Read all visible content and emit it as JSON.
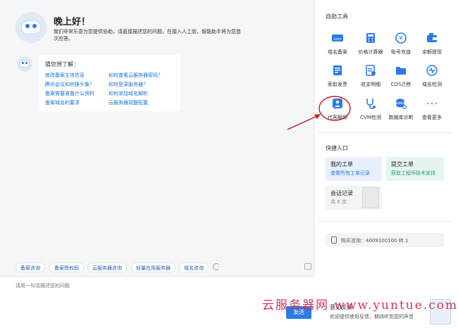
{
  "greeting": {
    "title": "晚上好！",
    "text": "我们非常乐意为您提供协助，请直接描述您的问题，在接入人工前，智能助手将为您首次应答。"
  },
  "guess": {
    "title": "猜您想了解：",
    "links": [
      "修改备案主体信息",
      "腾讯会议如何换头像？",
      "备案需要准备什么资料",
      "备案域名的要求",
      "如何查看云服务器密码？",
      "如何登录服务器？",
      "如何添加域名解析",
      "云服务器调整配置"
    ]
  },
  "quick_buttons": [
    "备案咨询",
    "备案授权码",
    "云服务器咨询",
    "轻量应用服务器",
    "域名咨询"
  ],
  "input": {
    "placeholder": "请用一句话描述您的问题",
    "send_label": "发送"
  },
  "self_service": {
    "title": "自助工具",
    "tools": [
      {
        "label": "域名备案",
        "icon": "com-icon"
      },
      {
        "label": "价格计算器",
        "icon": "calculator-icon"
      },
      {
        "label": "账号充值",
        "icon": "recharge-icon"
      },
      {
        "label": "余额提现",
        "icon": "withdraw-icon"
      },
      {
        "label": "索取发票",
        "icon": "invoice-icon"
      },
      {
        "label": "收支明细",
        "icon": "statement-icon"
      },
      {
        "label": "COS迁移",
        "icon": "folder-icon"
      },
      {
        "label": "域名检测",
        "icon": "pulse-icon"
      },
      {
        "label": "代客解绑",
        "icon": "user-unbind-icon"
      },
      {
        "label": "CVM检测",
        "icon": "stethoscope-icon"
      },
      {
        "label": "数据库诊断",
        "icon": "database-icon"
      },
      {
        "label": "查看更多",
        "icon": "more-icon"
      }
    ]
  },
  "quick_entry": {
    "title": "快捷入口",
    "my_ticket": {
      "title": "我的工单",
      "sub": "查看所有工单记录"
    },
    "submit_ticket": {
      "title": "提交工单",
      "sub": "获取工程师技术支持"
    },
    "session": {
      "title": "会话记录",
      "sub": "共 0 次"
    }
  },
  "phone": {
    "text": "购买咨询：4009100100 转 1"
  },
  "feedback": {
    "title": "意见反馈",
    "sub": "欢迎提供使用反馈，期待听到您的声音"
  },
  "watermark": "云服务器网 www.yuntue.com",
  "colors": {
    "primary": "#2a7be4",
    "green": "#1aa36a",
    "annotation": "#c8141e"
  }
}
